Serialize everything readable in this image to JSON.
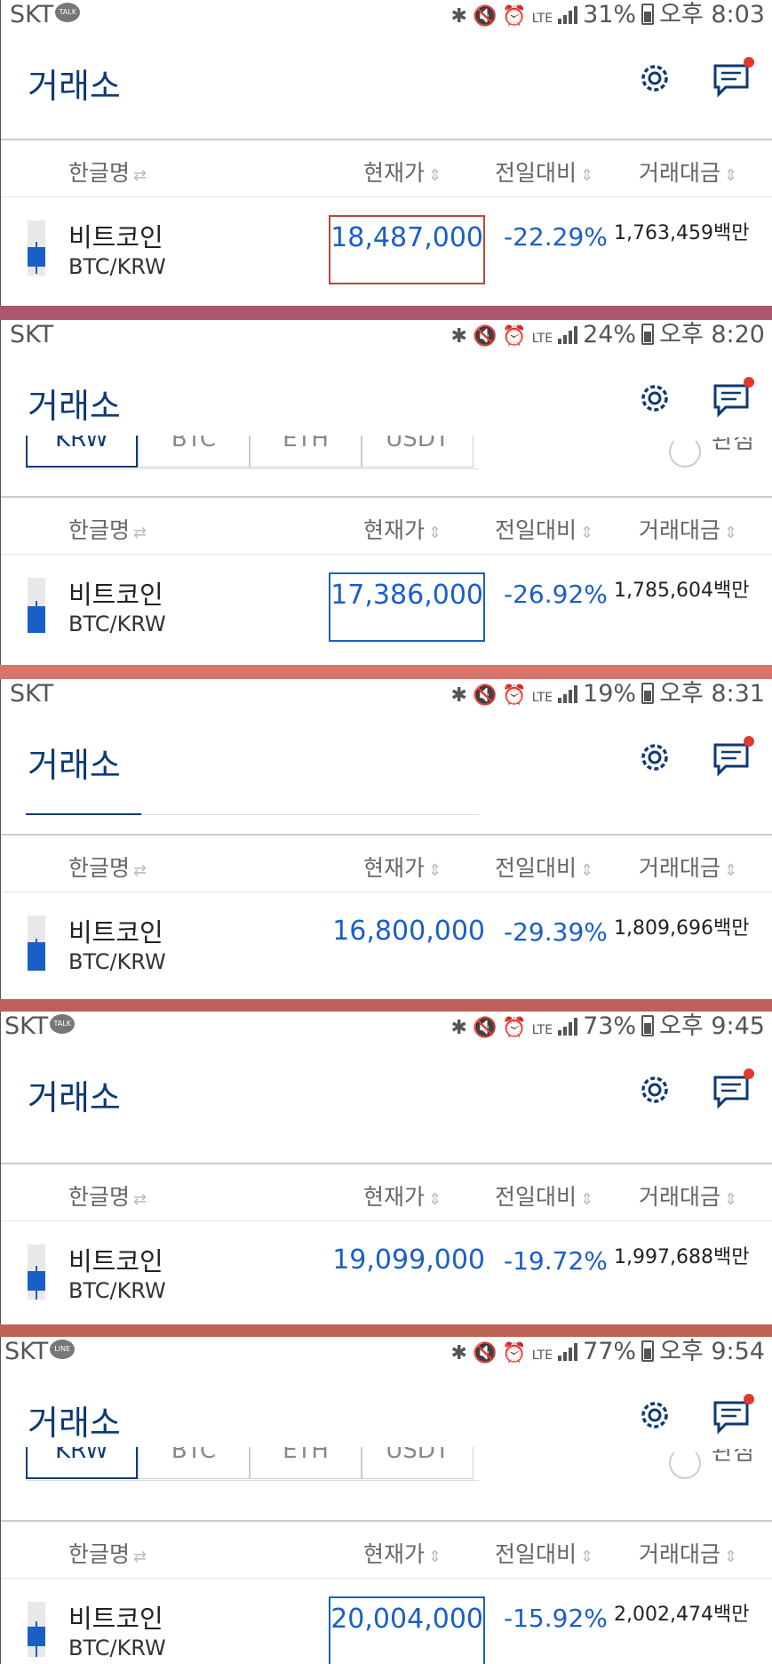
{
  "screens": [
    {
      "carrier": "SKT",
      "notif": "TALK",
      "battery": "31%",
      "time": "오후 8:03",
      "title": "거래소",
      "columns": {
        "name": "한글명",
        "price": "현재가",
        "change": "전일대비",
        "volume": "거래대금"
      },
      "coin": {
        "name": "비트코인",
        "pair": "BTC/KRW",
        "price": "18,487,000",
        "change": "-22.29%",
        "volume": "1,763,459백만",
        "price_box_color": "#b54a3a"
      }
    },
    {
      "carrier": "SKT",
      "notif": "",
      "battery": "24%",
      "time": "오후 8:20",
      "title": "거래소",
      "tabs": [
        "KRW",
        "BTC",
        "ETH",
        "USDT"
      ],
      "radio_label": "관심",
      "columns": {
        "name": "한글명",
        "price": "현재가",
        "change": "전일대비",
        "volume": "거래대금"
      },
      "coin": {
        "name": "비트코인",
        "pair": "BTC/KRW",
        "price": "17,386,000",
        "change": "-26.92%",
        "volume": "1,785,604백만",
        "price_box_color": "#1a5fc7"
      }
    },
    {
      "carrier": "SKT",
      "notif": "",
      "battery": "19%",
      "time": "오후 8:31",
      "title": "거래소",
      "columns": {
        "name": "한글명",
        "price": "현재가",
        "change": "전일대비",
        "volume": "거래대금"
      },
      "coin": {
        "name": "비트코인",
        "pair": "BTC/KRW",
        "price": "16,800,000",
        "change": "-29.39%",
        "volume": "1,809,696백만",
        "price_box_color": ""
      }
    },
    {
      "carrier": "SKT",
      "notif": "TALK",
      "battery": "73%",
      "time": "오후 9:45",
      "title": "거래소",
      "columns": {
        "name": "한글명",
        "price": "현재가",
        "change": "전일대비",
        "volume": "거래대금"
      },
      "coin": {
        "name": "비트코인",
        "pair": "BTC/KRW",
        "price": "19,099,000",
        "change": "-19.72%",
        "volume": "1,997,688백만",
        "price_box_color": ""
      }
    },
    {
      "carrier": "SKT",
      "notif": "LINE",
      "battery": "77%",
      "time": "오후 9:54",
      "title": "거래소",
      "tabs": [
        "KRW",
        "BTC",
        "ETH",
        "USDT"
      ],
      "radio_label": "관심",
      "columns": {
        "name": "한글명",
        "price": "현재가",
        "change": "전일대비",
        "volume": "거래대금"
      },
      "coin": {
        "name": "비트코인",
        "pair": "BTC/KRW",
        "price": "20,004,000",
        "change": "-15.92%",
        "volume": "2,002,474백만",
        "price_box_color": "#1a5fc7"
      }
    }
  ],
  "colors": {
    "title": "#0d3a73",
    "accent_blue": "#1a5fc7",
    "badge_red": "#e03a2f"
  }
}
